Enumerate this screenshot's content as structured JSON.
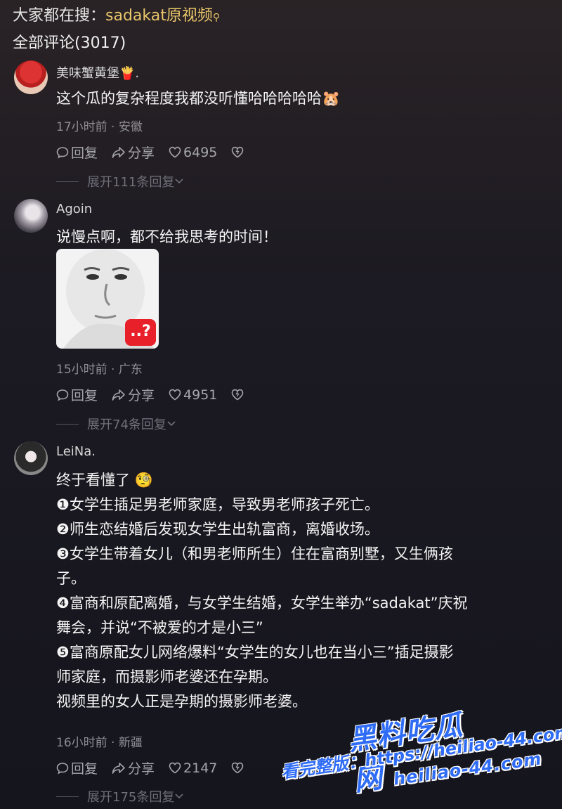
{
  "header": {
    "search_prefix": "大家都在搜：",
    "search_keyword": "sadakat原视频",
    "comment_count_title": "全部评论(3017)"
  },
  "comments": [
    {
      "username": "美味蟹黄堡",
      "username_suffix": "🍟.",
      "text": "这个瓜的复杂程度我都没听懂哈哈哈哈哈",
      "emoji": "🐹",
      "meta": "17小时前 · 安徽",
      "reply_label": "回复",
      "share_label": "分享",
      "likes": "6495",
      "expand_label": "展开111条回复"
    },
    {
      "username": "Agoin",
      "text": "说慢点啊，都不给我思考的时间！",
      "sticker_badge": "..?",
      "meta": "15小时前 · 广东",
      "reply_label": "回复",
      "share_label": "分享",
      "likes": "4951",
      "expand_label": "展开74条回复"
    },
    {
      "username": "LeiNa.",
      "lines": [
        "终于看懂了 🧐",
        "❶女学生插足男老师家庭，导致男老师孩子死亡。",
        "❷师生恋结婚后发现女学生出轨富商，离婚收场。",
        "❸女学生带着女儿（和男老师所生）住在富商别墅，又生俩孩",
        "子。",
        "❹富商和原配离婚，与女学生结婚，女学生举办“sadakat”庆祝",
        "舞会，并说“不被爱的才是小三”",
        "❺富商原配女儿网络爆料“女学生的女儿也在当小三”插足摄影",
        "师家庭，而摄影师老婆还在孕期。",
        "视频里的女人正是孕期的摄影师老婆。"
      ],
      "meta": "16小时前 · 新疆",
      "reply_label": "回复",
      "share_label": "分享",
      "likes": "2147",
      "expand_label": "展开175条回复"
    }
  ],
  "watermark": {
    "brand": "黑料吃瓜网",
    "domain_text": "heiliao-44.com",
    "full_line": "看完整版：https://heiliao-44.com"
  }
}
